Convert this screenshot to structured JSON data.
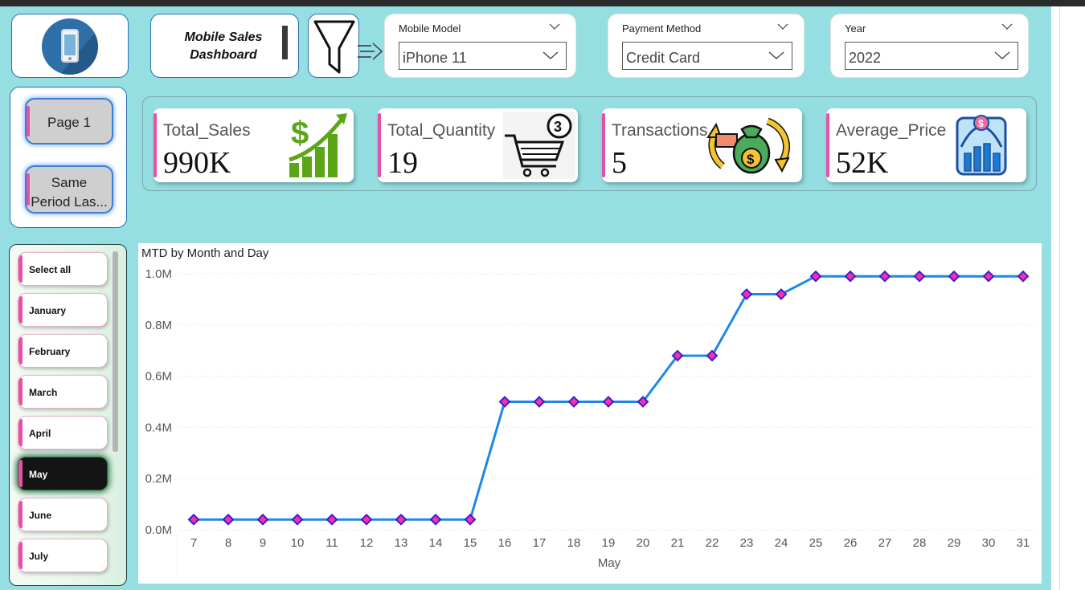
{
  "header": {
    "title_line1": "Mobile Sales",
    "title_line2": "Dashboard"
  },
  "slicers": [
    {
      "label": "Mobile Model",
      "value": "iPhone 11"
    },
    {
      "label": "Payment Method",
      "value": "Credit Card"
    },
    {
      "label": "Year",
      "value": "2022"
    }
  ],
  "page_nav": {
    "page1_label": "Page 1",
    "page2_label_line1": "Same",
    "page2_label_line2": "Period Las..."
  },
  "kpis": [
    {
      "label": "Total_Sales",
      "value": "990K",
      "icon": "growth-chart-dollar-icon"
    },
    {
      "label": "Total_Quantity",
      "value": "19",
      "icon": "shopping-cart-icon"
    },
    {
      "label": "Transactions",
      "value": "5",
      "icon": "money-exchange-icon"
    },
    {
      "label": "Average_Price",
      "value": "52K",
      "icon": "price-bell-curve-icon"
    }
  ],
  "months": {
    "items": [
      "Select all",
      "January",
      "February",
      "March",
      "April",
      "May",
      "June",
      "July"
    ],
    "selected": "May"
  },
  "colors": {
    "canvas": "#95dfe2",
    "accent_pink": "#ea4fa6",
    "line": "#1e88e5",
    "marker_fill": "#ff2ea6",
    "marker_stroke": "#3a1fd1"
  },
  "chart_data": {
    "type": "line",
    "title": "MTD by Month and Day",
    "xlabel": "May",
    "ylabel": "",
    "x": [
      7,
      8,
      9,
      10,
      11,
      12,
      13,
      14,
      15,
      16,
      17,
      18,
      19,
      20,
      21,
      22,
      23,
      24,
      25,
      26,
      27,
      28,
      29,
      30,
      31
    ],
    "series": [
      {
        "values": [
          0.04,
          0.04,
          0.04,
          0.04,
          0.04,
          0.04,
          0.04,
          0.04,
          0.04,
          0.5,
          0.5,
          0.5,
          0.5,
          0.5,
          0.68,
          0.68,
          0.92,
          0.92,
          0.99,
          0.99,
          0.99,
          0.99,
          0.99,
          0.99,
          0.99
        ]
      }
    ],
    "yticks": [
      "0.0M",
      "0.2M",
      "0.4M",
      "0.6M",
      "0.8M",
      "1.0M"
    ],
    "ylim": [
      0,
      1.0
    ],
    "grid": true
  }
}
